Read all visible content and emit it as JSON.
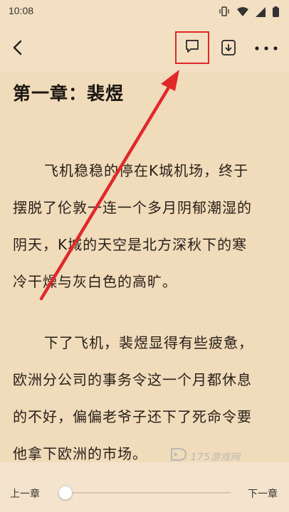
{
  "status_bar": {
    "time": "10:08"
  },
  "toolbar": {
    "icons": {
      "back": "back-chevron-icon",
      "comment": "comment-icon",
      "download": "download-icon",
      "more": "more-icon"
    },
    "highlight_color": "#e0282a"
  },
  "chapter": {
    "title": "第一章：裴煜",
    "paragraphs": [
      {
        "lines": [
          "飞机稳稳的停在K城机场，终于",
          "摆脱了伦敦一连一个多月阴郁潮湿的",
          "阴天，K城的天空是北方深秋下的寒",
          "冷干燥与灰白色的高旷。"
        ]
      },
      {
        "lines": [
          "下了飞机，裴煜显得有些疲惫，",
          "欧洲分公司的事务令这一个月都休息",
          "的不好，偏偏老爷子还下了死命令要",
          "他拿下欧洲的市场。"
        ]
      }
    ]
  },
  "watermark": {
    "text": "175游戏网"
  },
  "bottom_bar": {
    "prev_label": "上一章",
    "next_label": "下一章",
    "progress": 0.0
  },
  "colors": {
    "page_background": "#f0dbbb",
    "annotation_red": "#e0282a"
  }
}
